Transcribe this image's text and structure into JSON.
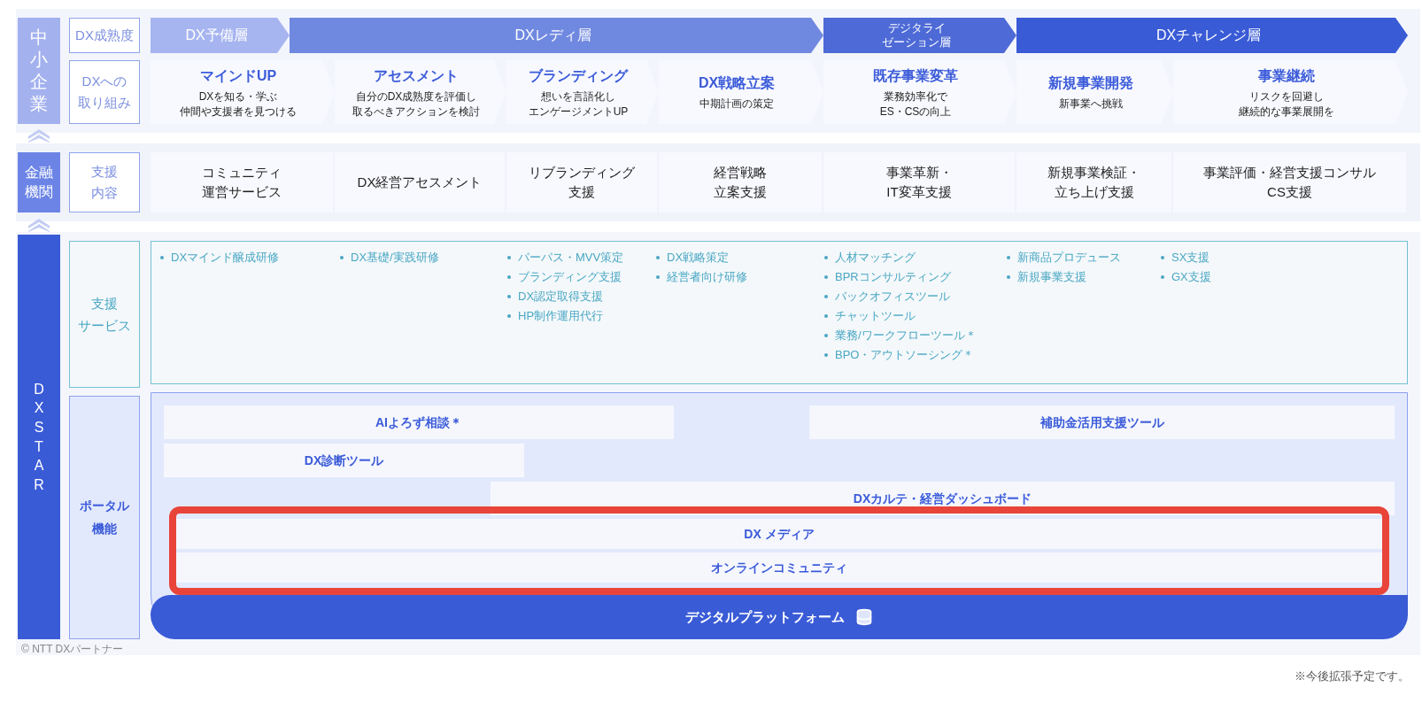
{
  "sme": {
    "label": "中小企業",
    "maturity_label": "DX成熟度",
    "efforts_label": [
      "DXへの",
      "取り組み"
    ],
    "phases": [
      {
        "label": [
          "DX予備層"
        ]
      },
      {
        "label": [
          "DXレディ層"
        ]
      },
      {
        "label": [
          "デジタライ",
          "ゼーション層"
        ]
      },
      {
        "label": [
          "DXチャレンジ層"
        ]
      }
    ],
    "steps": [
      {
        "title": "マインドUP",
        "description": [
          "DXを知る・学ぶ",
          "仲間や支援者を見つける"
        ]
      },
      {
        "title": "アセスメント",
        "description": [
          "自分のDX成熟度を評価し",
          "取るべきアクションを検討"
        ]
      },
      {
        "title": "ブランディング",
        "description": [
          "想いを言語化し",
          "エンゲージメントUP"
        ]
      },
      {
        "title": "DX戦略立案",
        "description": [
          "中期計画の策定"
        ]
      },
      {
        "title": "既存事業変革",
        "description": [
          "業務効率化で",
          "ES・CSの向上"
        ]
      },
      {
        "title": "新規事業開発",
        "description": [
          "新事業へ挑戦"
        ]
      },
      {
        "title": "事業継続",
        "description": [
          "リスクを回避し",
          "継続的な事業展開を"
        ]
      }
    ]
  },
  "finance": {
    "label": [
      "金融",
      "機関"
    ],
    "support_label": [
      "支援",
      "内容"
    ],
    "supports": [
      [
        "コミュニティ",
        "運営サービス"
      ],
      [
        "DX経営アセスメント"
      ],
      [
        "リブランディング",
        "支援"
      ],
      [
        "経営戦略",
        "立案支援"
      ],
      [
        "事業革新・",
        "IT変革支援"
      ],
      [
        "新規事業検証・",
        "立ち上げ支援"
      ],
      [
        "事業評価・経営支援コンサル",
        "CS支援"
      ]
    ]
  },
  "dxstar": {
    "label": "DXSTAR",
    "services_label": [
      "支援",
      "サービス"
    ],
    "services": [
      [
        "DXマインド醸成研修"
      ],
      [
        "DX基礎/実践研修"
      ],
      [
        "パーパス・MVV策定",
        "ブランディング支援",
        "DX認定取得支援",
        "HP制作運用代行"
      ],
      [
        "DX戦略策定",
        "経営者向け研修"
      ],
      [
        "人材マッチング",
        "BPRコンサルティング",
        "バックオフィスツール",
        "チャットツール",
        "業務/ワークフローツール＊",
        "BPO・アウトソーシング＊"
      ],
      [
        "新商品プロデュース",
        "新規事業支援"
      ],
      [
        "SX支援",
        "GX支援"
      ]
    ],
    "portal_label": [
      "ポータル",
      "機能"
    ],
    "portal_rows": [
      [
        "AIよろず相談＊",
        "補助金活用支援ツール"
      ],
      [
        "DX診断ツール"
      ],
      [
        "DXカルテ・経営ダッシュボード"
      ]
    ],
    "highlighted_rows": [
      "DX メディア",
      "オンラインコミュニティ"
    ],
    "platform": "デジタルプラットフォーム"
  },
  "copyright": "© NTT DXパートナー",
  "note": "※今後拡張予定です。"
}
